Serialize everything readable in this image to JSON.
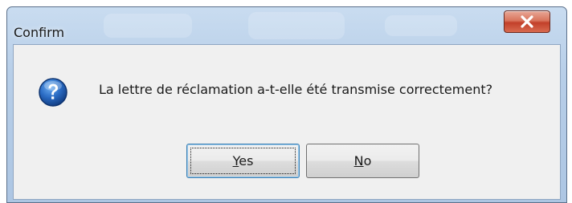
{
  "dialog": {
    "title": "Confirm",
    "message": "La lettre de réclamation a-t-elle été transmise correctement?",
    "icon": "question-icon",
    "buttons": {
      "yes": {
        "mnemonic": "Y",
        "rest": "es"
      },
      "no": {
        "mnemonic": "N",
        "rest": "o"
      }
    },
    "close_icon": "close-icon"
  },
  "colors": {
    "frame": "#b7cee8",
    "close_button": "#c2402a",
    "client_background": "#f0f0f0",
    "question_icon": "#1f5db8"
  }
}
